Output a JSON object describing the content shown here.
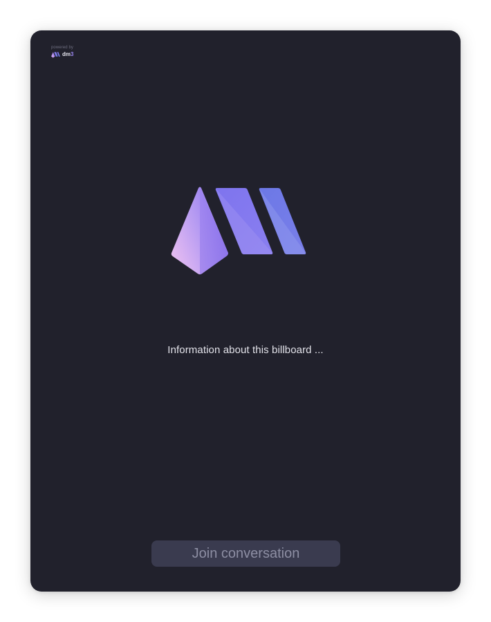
{
  "branding": {
    "powered_by": "powered by",
    "brand_prefix": "dm",
    "brand_suffix": "3",
    "logo_icon": "dm3-logo-icon"
  },
  "main": {
    "info_text": "Information about this billboard ...",
    "join_button_label": "Join conversation"
  },
  "colors": {
    "background": "#21212c",
    "button_bg": "#3a3b4f",
    "button_text": "#8d8ea3",
    "accent_purple": "#8b7cf0",
    "accent_pink": "#e3b6f0",
    "accent_blue": "#6f7fe8"
  }
}
